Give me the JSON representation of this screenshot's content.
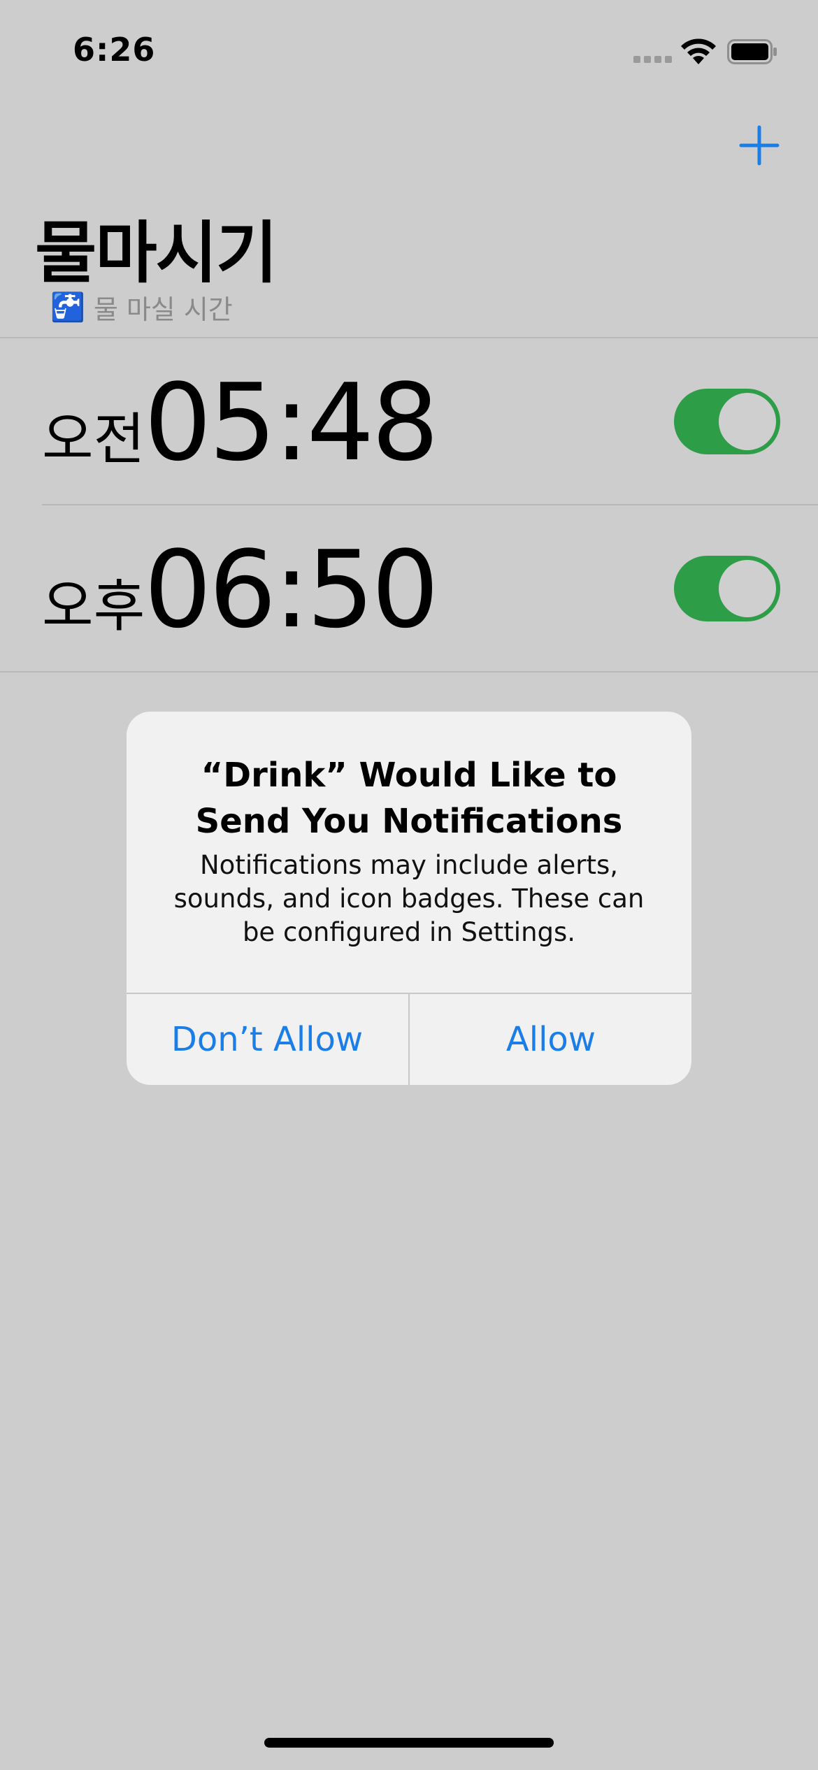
{
  "status_bar": {
    "time": "6:26",
    "icons": [
      "signal-dots-icon",
      "wifi-icon",
      "battery-icon"
    ]
  },
  "nav": {
    "add_icon": "plus-icon",
    "title": "물마시기",
    "subtitle": "물 마실 시간",
    "subtitle_emoji": "🚰"
  },
  "alarms": [
    {
      "ampm": "오전",
      "time": "05:48",
      "enabled": true
    },
    {
      "ampm": "오후",
      "time": "06:50",
      "enabled": true
    }
  ],
  "alert": {
    "title": "“Drink” Would Like to Send You Notifications",
    "message": "Notifications may include alerts, sounds, and icon badges. These can be configured in Settings.",
    "dont_allow": "Don’t Allow",
    "allow": "Allow"
  },
  "colors": {
    "accent": "#1a7ee6",
    "toggle_on": "#2d9d48",
    "background": "#cdcdcd"
  }
}
